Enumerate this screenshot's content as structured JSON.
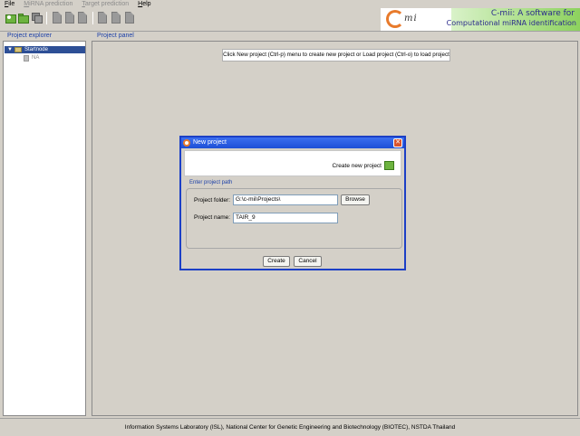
{
  "menu": [
    {
      "label": "File",
      "mnemonic": "F",
      "rest": "ile",
      "enabled": true
    },
    {
      "label": "MiRNA prediction",
      "mnemonic": "M",
      "rest": "iRNA prediction",
      "enabled": false
    },
    {
      "label": "Target prediction",
      "mnemonic": "T",
      "rest": "arget prediction",
      "enabled": false
    },
    {
      "label": "Help",
      "mnemonic": "H",
      "rest": "elp",
      "enabled": true
    }
  ],
  "toolbar": {
    "icons": [
      "new-project-icon",
      "open-project-icon",
      "save-icon",
      "doc-icon",
      "doc-icon",
      "doc-icon",
      "doc-icon",
      "doc-icon",
      "doc-icon"
    ]
  },
  "brand": {
    "logo_text": "mi",
    "line1": "C-mii: A software for",
    "line2": "Computational miRNA identification"
  },
  "explorer": {
    "title": "Project explorer",
    "root": "Startnode",
    "child": "NA"
  },
  "panel": {
    "title": "Project panel",
    "hint": "Click New project (Ctrl-p) menu to create new project or Load project (Ctrl-o) to load project"
  },
  "dialog": {
    "title": "New project",
    "header_text": "Create new project",
    "group_title": "Enter project path",
    "folder_label": "Project folder:",
    "folder_value": "G:\\c-mii\\Projects\\",
    "browse_label": "Browse",
    "name_label": "Project name:",
    "name_value": "TAIR_9",
    "create_label": "Create",
    "cancel_label": "Cancel"
  },
  "status": {
    "text": "Information Systems Laboratory (ISL), National Center for Genetic Engineering and Biotechnology (BIOTEC), NSTDA Thailand"
  },
  "colors": {
    "accent": "#1c3fc6",
    "section_title": "#1b3fa8",
    "selection": "#2d4f96",
    "brand_green": "#8dd25e",
    "logo_orange": "#e87a2b"
  }
}
